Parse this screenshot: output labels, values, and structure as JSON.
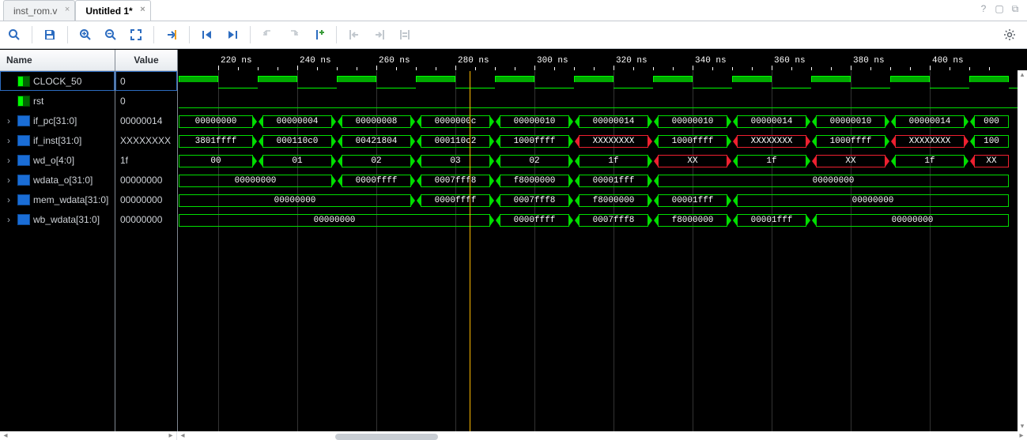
{
  "tabs": [
    {
      "label": "inst_rom.v",
      "active": false
    },
    {
      "label": "Untitled 1*",
      "active": true
    }
  ],
  "titlebuttons": {
    "help": "?",
    "max": "▢",
    "popout": "⧉"
  },
  "toolbar": {
    "search": "search-icon",
    "save": "save-icon",
    "zoomin": "zoom-in-icon",
    "zoomout": "zoom-out-icon",
    "zoomfit": "zoom-fit-icon",
    "gotocursor": "goto-cursor-icon",
    "first": "first-edge-icon",
    "last": "last-edge-icon",
    "prevtr": "prev-transition-icon",
    "nexttr": "next-transition-icon",
    "addmarker": "add-marker-icon",
    "prevm": "prev-marker-icon",
    "nextm": "next-marker-icon",
    "swap": "swap-markers-icon",
    "gear": "settings-icon"
  },
  "columns": {
    "name": "Name",
    "value": "Value"
  },
  "signals": [
    {
      "name": "CLOCK_50",
      "value": "0",
      "type": "bit",
      "sel": true,
      "expand": false
    },
    {
      "name": "rst",
      "value": "0",
      "type": "bit",
      "sel": false,
      "expand": false
    },
    {
      "name": "if_pc[31:0]",
      "value": "00000014",
      "type": "bus",
      "sel": false,
      "expand": true
    },
    {
      "name": "if_inst[31:0]",
      "value": "XXXXXXXX",
      "type": "bus",
      "sel": false,
      "expand": true
    },
    {
      "name": "wd_o[4:0]",
      "value": "1f",
      "type": "bus",
      "sel": false,
      "expand": true
    },
    {
      "name": "wdata_o[31:0]",
      "value": "00000000",
      "type": "bus",
      "sel": false,
      "expand": true
    },
    {
      "name": "mem_wdata[31:0]",
      "value": "00000000",
      "type": "bus",
      "sel": false,
      "expand": true
    },
    {
      "name": "wb_wdata[31:0]",
      "value": "00000000",
      "type": "bus",
      "sel": false,
      "expand": true
    }
  ],
  "ruler": {
    "offset": 210,
    "scale": 5.0,
    "unit": "ns",
    "ticks": [
      220,
      240,
      260,
      280,
      300,
      320,
      340,
      360,
      380,
      400
    ]
  },
  "clock": {
    "period": 20,
    "phase": 0,
    "start": 210
  },
  "cursor": 283.5,
  "waves": {
    "if_pc": [
      {
        "t0": 210,
        "t1": 230,
        "v": "00000000"
      },
      {
        "t0": 230,
        "t1": 250,
        "v": "00000004"
      },
      {
        "t0": 250,
        "t1": 270,
        "v": "00000008"
      },
      {
        "t0": 270,
        "t1": 290,
        "v": "0000000c"
      },
      {
        "t0": 290,
        "t1": 310,
        "v": "00000010"
      },
      {
        "t0": 310,
        "t1": 330,
        "v": "00000014"
      },
      {
        "t0": 330,
        "t1": 350,
        "v": "00000010"
      },
      {
        "t0": 350,
        "t1": 370,
        "v": "00000014"
      },
      {
        "t0": 370,
        "t1": 390,
        "v": "00000010"
      },
      {
        "t0": 390,
        "t1": 410,
        "v": "00000014"
      },
      {
        "t0": 410,
        "t1": 420,
        "v": "000"
      }
    ],
    "if_inst": [
      {
        "t0": 210,
        "t1": 230,
        "v": "3801ffff"
      },
      {
        "t0": 230,
        "t1": 250,
        "v": "000110c0"
      },
      {
        "t0": 250,
        "t1": 270,
        "v": "00421804"
      },
      {
        "t0": 270,
        "t1": 290,
        "v": "000110c2"
      },
      {
        "t0": 290,
        "t1": 310,
        "v": "1000ffff"
      },
      {
        "t0": 310,
        "t1": 330,
        "v": "XXXXXXXX",
        "x": true
      },
      {
        "t0": 330,
        "t1": 350,
        "v": "1000ffff"
      },
      {
        "t0": 350,
        "t1": 370,
        "v": "XXXXXXXX",
        "x": true
      },
      {
        "t0": 370,
        "t1": 390,
        "v": "1000ffff"
      },
      {
        "t0": 390,
        "t1": 410,
        "v": "XXXXXXXX",
        "x": true
      },
      {
        "t0": 410,
        "t1": 420,
        "v": "100"
      }
    ],
    "wd_o": [
      {
        "t0": 210,
        "t1": 230,
        "v": "00"
      },
      {
        "t0": 230,
        "t1": 250,
        "v": "01"
      },
      {
        "t0": 250,
        "t1": 270,
        "v": "02"
      },
      {
        "t0": 270,
        "t1": 290,
        "v": "03"
      },
      {
        "t0": 290,
        "t1": 310,
        "v": "02"
      },
      {
        "t0": 310,
        "t1": 330,
        "v": "1f"
      },
      {
        "t0": 330,
        "t1": 350,
        "v": "XX",
        "x": true
      },
      {
        "t0": 350,
        "t1": 370,
        "v": "1f"
      },
      {
        "t0": 370,
        "t1": 390,
        "v": "XX",
        "x": true
      },
      {
        "t0": 390,
        "t1": 410,
        "v": "1f"
      },
      {
        "t0": 410,
        "t1": 420,
        "v": "XX",
        "x": true
      }
    ],
    "wdata_o": [
      {
        "t0": 210,
        "t1": 250,
        "v": "00000000"
      },
      {
        "t0": 250,
        "t1": 270,
        "v": "0000ffff"
      },
      {
        "t0": 270,
        "t1": 290,
        "v": "0007fff8"
      },
      {
        "t0": 290,
        "t1": 310,
        "v": "f8000000"
      },
      {
        "t0": 310,
        "t1": 330,
        "v": "00001fff"
      },
      {
        "t0": 330,
        "t1": 420,
        "v": "00000000"
      }
    ],
    "mem_wdata": [
      {
        "t0": 210,
        "t1": 270,
        "v": "00000000"
      },
      {
        "t0": 270,
        "t1": 290,
        "v": "0000ffff"
      },
      {
        "t0": 290,
        "t1": 310,
        "v": "0007fff8"
      },
      {
        "t0": 310,
        "t1": 330,
        "v": "f8000000"
      },
      {
        "t0": 330,
        "t1": 350,
        "v": "00001fff"
      },
      {
        "t0": 350,
        "t1": 420,
        "v": "00000000"
      }
    ],
    "wb_wdata": [
      {
        "t0": 210,
        "t1": 290,
        "v": "00000000"
      },
      {
        "t0": 290,
        "t1": 310,
        "v": "0000ffff"
      },
      {
        "t0": 310,
        "t1": 330,
        "v": "0007fff8"
      },
      {
        "t0": 330,
        "t1": 350,
        "v": "f8000000"
      },
      {
        "t0": 350,
        "t1": 370,
        "v": "00001fff"
      },
      {
        "t0": 370,
        "t1": 420,
        "v": "00000000"
      }
    ]
  }
}
